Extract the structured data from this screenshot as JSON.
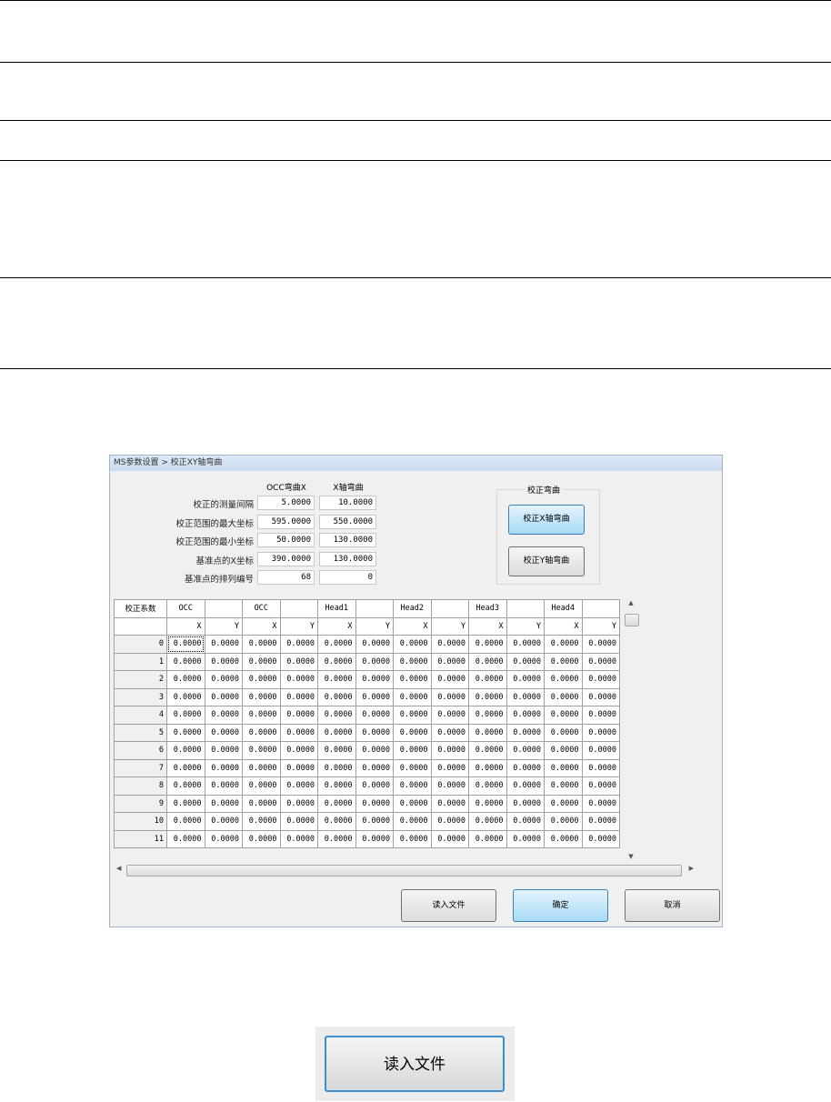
{
  "dialog": {
    "title": "MS参数设置 > 校正XY轴弯曲",
    "form": {
      "col_headers": [
        "OCC弯曲X",
        "X轴弯曲"
      ],
      "rows": [
        {
          "label": "校正的测量间隔",
          "v1": "5.0000",
          "v2": "10.0000"
        },
        {
          "label": "校正范围的最大坐标",
          "v1": "595.0000",
          "v2": "550.0000"
        },
        {
          "label": "校正范围的最小坐标",
          "v1": "50.0000",
          "v2": "130.0000"
        },
        {
          "label": "基准点的X坐标",
          "v1": "390.0000",
          "v2": "130.0000"
        },
        {
          "label": "基准点的排列编号",
          "v1": "68",
          "v2": "0"
        }
      ]
    },
    "group": {
      "title": "校正弯曲",
      "btn_x": "校正X轴弯曲",
      "btn_y": "校正Y轴弯曲"
    },
    "table": {
      "corner": "校正系数",
      "groups": [
        "OCC",
        "",
        "OCC",
        "",
        "Head1",
        "",
        "Head2",
        "",
        "Head3",
        "",
        "Head4",
        ""
      ],
      "sub": [
        "X",
        "Y",
        "X",
        "Y",
        "X",
        "Y",
        "X",
        "Y",
        "X",
        "Y",
        "X",
        "Y"
      ],
      "row_labels": [
        "0",
        "1",
        "2",
        "3",
        "4",
        "5",
        "6",
        "7",
        "8",
        "9",
        "10",
        "11"
      ],
      "cell_value": "0.0000"
    },
    "buttons": {
      "read": "读入文件",
      "ok": "确定",
      "cancel": "取消"
    }
  },
  "zoomed_button": {
    "label": "读入文件"
  }
}
